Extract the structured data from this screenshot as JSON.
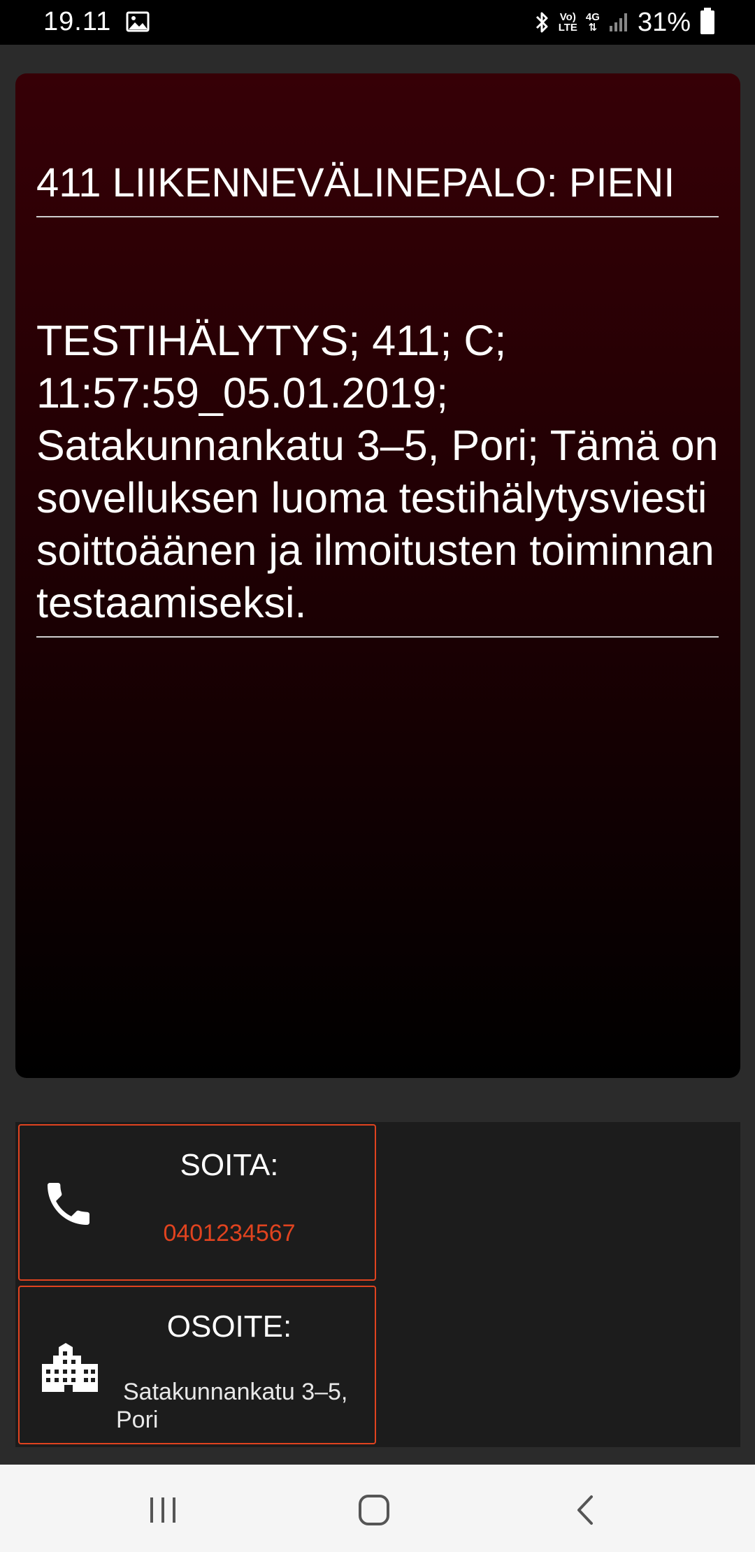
{
  "status_bar": {
    "time": "19.11",
    "volte_label_top": "Vo)",
    "volte_label_bottom": "LTE",
    "network_label": "4G",
    "battery_percent": "31%",
    "icons": [
      "image-icon",
      "bluetooth-icon",
      "volte-icon",
      "4g-data-icon",
      "signal-icon",
      "battery-icon"
    ]
  },
  "alert": {
    "title": "411 LIIKENNEVÄLINEPALO: PIENI",
    "message": "TESTIHÄLYTYS; 411; C; 11:57:59_05.01.2019; Satakunnankatu 3–5, Pori; Tämä on sovelluksen luoma testihälytysviesti soittoäänen ja ilmoitusten toiminnan testaamiseksi."
  },
  "call_card": {
    "label": "SOITA:",
    "phone": "0401234567",
    "icon": "phone-icon"
  },
  "address_card": {
    "label": "OSOITE:",
    "address": "Satakunnankatu 3–5, Pori",
    "icon": "building-icon"
  },
  "nav_bar": {
    "icons": [
      "recents-icon",
      "home-icon",
      "back-icon"
    ]
  },
  "colors": {
    "accent": "#e0431f",
    "card_top": "#360006",
    "card_bottom": "#000000",
    "panel": "#1c1c1c",
    "background": "#2b2b2b",
    "navbar": "#f5f5f5"
  }
}
